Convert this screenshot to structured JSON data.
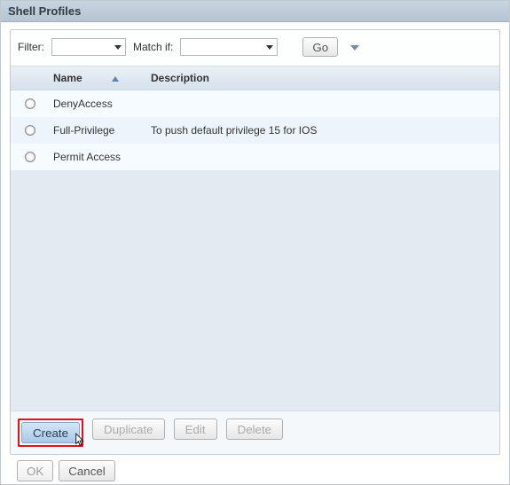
{
  "window": {
    "title": "Shell Profiles"
  },
  "filter": {
    "label": "Filter:",
    "value": "",
    "match_label": "Match if:",
    "match_value": "",
    "go": "Go"
  },
  "table": {
    "columns": {
      "name": "Name",
      "description": "Description"
    },
    "rows": [
      {
        "name": "DenyAccess",
        "description": ""
      },
      {
        "name": "Full-Privilege",
        "description": "To push default privilege 15 for IOS"
      },
      {
        "name": "Permit Access",
        "description": ""
      }
    ]
  },
  "actions": {
    "create": "Create",
    "duplicate": "Duplicate",
    "edit": "Edit",
    "delete": "Delete"
  },
  "footer": {
    "ok": "OK",
    "cancel": "Cancel"
  }
}
